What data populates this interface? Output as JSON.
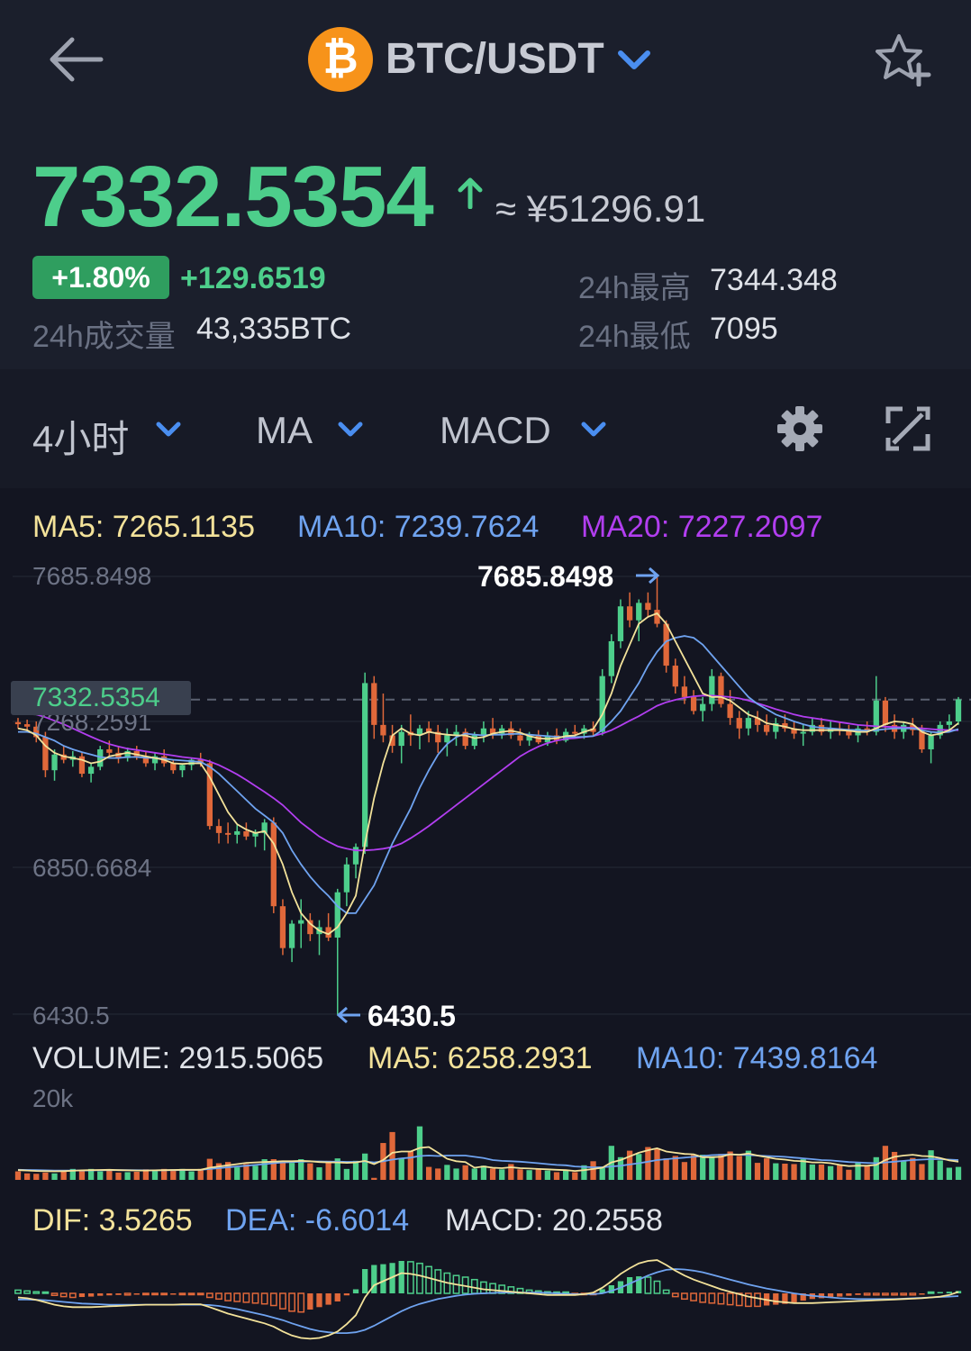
{
  "header": {
    "pair": "BTC/USDT",
    "coin_symbol": "₿",
    "back_icon": "arrow-left-icon",
    "star_icon": "star-plus-icon"
  },
  "ticker": {
    "price": "7332.5354",
    "approx": "≈ ¥51296.91",
    "change_pct": "+1.80%",
    "change_abs": "+129.6519",
    "high_label": "24h最高",
    "high_value": "7344.348",
    "low_label": "24h最低",
    "low_value": "7095",
    "volume_label": "24h成交量",
    "volume_value": "43,335BTC"
  },
  "toolbar": {
    "interval": "4小时",
    "main_indicator": "MA",
    "sub_indicator": "MACD"
  },
  "ma_legend": {
    "ma5": "MA5: 7265.1135",
    "ma10": "MA10: 7239.7624",
    "ma20": "MA20: 7227.2097"
  },
  "price_axis": {
    "top": "7685.8498",
    "mid": "7268.2591",
    "low": "6850.6684",
    "bottom": "6430.5",
    "current_tag": "7332.5354",
    "max_marker": "7685.8498",
    "min_marker": "6430.5"
  },
  "volume_legend": {
    "volume": "VOLUME: 2915.5065",
    "ma5": "MA5: 6258.2931",
    "ma10": "MA10: 7439.8164",
    "axis_top": "20k"
  },
  "macd_legend": {
    "dif": "DIF: 3.5265",
    "dea": "DEA: -6.6014",
    "macd": "MACD: 20.2558"
  },
  "colors": {
    "up": "#4dce8b",
    "down": "#e0683a",
    "ma5": "#f3e29a",
    "ma10": "#6fa3f0",
    "ma20": "#b23ef0",
    "background": "#131521"
  },
  "chart_data": {
    "type": "candlestick",
    "y_range": [
      6430.5,
      7685.8498
    ],
    "current_price": 7332.5354,
    "candles": [
      [
        7268,
        7280,
        7250,
        7262
      ],
      [
        7262,
        7275,
        7240,
        7255
      ],
      [
        7255,
        7270,
        7210,
        7225
      ],
      [
        7225,
        7240,
        7110,
        7130
      ],
      [
        7130,
        7190,
        7100,
        7175
      ],
      [
        7175,
        7200,
        7150,
        7160
      ],
      [
        7160,
        7185,
        7140,
        7170
      ],
      [
        7170,
        7180,
        7110,
        7120
      ],
      [
        7120,
        7150,
        7095,
        7140
      ],
      [
        7140,
        7200,
        7130,
        7190
      ],
      [
        7190,
        7215,
        7170,
        7180
      ],
      [
        7180,
        7200,
        7150,
        7165
      ],
      [
        7165,
        7195,
        7155,
        7185
      ],
      [
        7185,
        7200,
        7160,
        7170
      ],
      [
        7170,
        7185,
        7140,
        7150
      ],
      [
        7150,
        7180,
        7130,
        7170
      ],
      [
        7170,
        7190,
        7140,
        7150
      ],
      [
        7150,
        7160,
        7120,
        7130
      ],
      [
        7130,
        7150,
        7110,
        7145
      ],
      [
        7145,
        7165,
        7130,
        7160
      ],
      [
        7160,
        7180,
        7140,
        7150
      ],
      [
        7150,
        7160,
        6960,
        6970
      ],
      [
        6970,
        6990,
        6920,
        6950
      ],
      [
        6950,
        6980,
        6920,
        6945
      ],
      [
        6945,
        6975,
        6920,
        6955
      ],
      [
        6955,
        6980,
        6930,
        6940
      ],
      [
        6940,
        6960,
        6910,
        6950
      ],
      [
        6950,
        6990,
        6900,
        6980
      ],
      [
        6980,
        6995,
        6720,
        6740
      ],
      [
        6740,
        6760,
        6600,
        6620
      ],
      [
        6620,
        6700,
        6580,
        6690
      ],
      [
        6690,
        6760,
        6620,
        6700
      ],
      [
        6700,
        6720,
        6640,
        6660
      ],
      [
        6660,
        6700,
        6600,
        6680
      ],
      [
        6680,
        6720,
        6640,
        6650
      ],
      [
        6650,
        6790,
        6430,
        6780
      ],
      [
        6780,
        6880,
        6740,
        6860
      ],
      [
        6860,
        6920,
        6820,
        6910
      ],
      [
        6910,
        7410,
        6890,
        7380
      ],
      [
        7380,
        7400,
        7220,
        7260
      ],
      [
        7260,
        7350,
        7210,
        7230
      ],
      [
        7230,
        7260,
        7180,
        7200
      ],
      [
        7200,
        7260,
        7150,
        7240
      ],
      [
        7240,
        7290,
        7200,
        7230
      ],
      [
        7230,
        7260,
        7190,
        7250
      ],
      [
        7250,
        7270,
        7210,
        7240
      ],
      [
        7240,
        7260,
        7180,
        7210
      ],
      [
        7210,
        7250,
        7170,
        7230
      ],
      [
        7230,
        7260,
        7200,
        7240
      ],
      [
        7240,
        7250,
        7190,
        7200
      ],
      [
        7200,
        7240,
        7190,
        7230
      ],
      [
        7230,
        7270,
        7210,
        7250
      ],
      [
        7250,
        7280,
        7220,
        7235
      ],
      [
        7235,
        7260,
        7220,
        7250
      ],
      [
        7250,
        7270,
        7220,
        7230
      ],
      [
        7230,
        7250,
        7200,
        7215
      ],
      [
        7215,
        7240,
        7200,
        7230
      ],
      [
        7230,
        7245,
        7205,
        7210
      ],
      [
        7210,
        7240,
        7200,
        7230
      ],
      [
        7230,
        7250,
        7205,
        7215
      ],
      [
        7215,
        7250,
        7210,
        7240
      ],
      [
        7240,
        7260,
        7220,
        7235
      ],
      [
        7235,
        7260,
        7220,
        7250
      ],
      [
        7250,
        7270,
        7230,
        7240
      ],
      [
        7240,
        7420,
        7230,
        7400
      ],
      [
        7400,
        7520,
        7380,
        7500
      ],
      [
        7500,
        7620,
        7480,
        7600
      ],
      [
        7600,
        7640,
        7540,
        7560
      ],
      [
        7560,
        7620,
        7500,
        7610
      ],
      [
        7610,
        7640,
        7570,
        7590
      ],
      [
        7590,
        7686,
        7540,
        7550
      ],
      [
        7550,
        7560,
        7410,
        7430
      ],
      [
        7430,
        7450,
        7350,
        7370
      ],
      [
        7370,
        7400,
        7320,
        7340
      ],
      [
        7340,
        7360,
        7290,
        7300
      ],
      [
        7300,
        7340,
        7270,
        7320
      ],
      [
        7320,
        7420,
        7300,
        7400
      ],
      [
        7400,
        7410,
        7310,
        7320
      ],
      [
        7320,
        7360,
        7260,
        7280
      ],
      [
        7280,
        7300,
        7220,
        7250
      ],
      [
        7250,
        7300,
        7230,
        7280
      ],
      [
        7280,
        7300,
        7240,
        7260
      ],
      [
        7260,
        7290,
        7230,
        7240
      ],
      [
        7240,
        7280,
        7220,
        7265
      ],
      [
        7265,
        7290,
        7240,
        7250
      ],
      [
        7250,
        7270,
        7220,
        7235
      ],
      [
        7235,
        7260,
        7200,
        7240
      ],
      [
        7240,
        7280,
        7230,
        7260
      ],
      [
        7260,
        7280,
        7230,
        7240
      ],
      [
        7240,
        7270,
        7220,
        7250
      ],
      [
        7250,
        7270,
        7230,
        7245
      ],
      [
        7245,
        7260,
        7220,
        7230
      ],
      [
        7230,
        7260,
        7210,
        7250
      ],
      [
        7250,
        7270,
        7230,
        7240
      ],
      [
        7240,
        7400,
        7230,
        7330
      ],
      [
        7330,
        7340,
        7240,
        7260
      ],
      [
        7260,
        7290,
        7220,
        7240
      ],
      [
        7240,
        7270,
        7220,
        7260
      ],
      [
        7260,
        7280,
        7230,
        7245
      ],
      [
        7245,
        7260,
        7180,
        7190
      ],
      [
        7190,
        7240,
        7150,
        7230
      ],
      [
        7230,
        7270,
        7220,
        7260
      ],
      [
        7260,
        7290,
        7240,
        7270
      ],
      [
        7270,
        7340,
        7260,
        7333
      ]
    ],
    "ma5": [
      7250,
      7245,
      7230,
      7200,
      7180,
      7170,
      7165,
      7160,
      7150,
      7155,
      7170,
      7175,
      7180,
      7175,
      7170,
      7165,
      7160,
      7150,
      7148,
      7150,
      7150,
      7110,
      7060,
      7010,
      6975,
      6960,
      6950,
      6955,
      6920,
      6860,
      6780,
      6720,
      6690,
      6670,
      6660,
      6680,
      6720,
      6770,
      6920,
      7050,
      7150,
      7230,
      7250,
      7235,
      7230,
      7240,
      7235,
      7232,
      7230,
      7230,
      7222,
      7225,
      7235,
      7240,
      7243,
      7238,
      7228,
      7222,
      7220,
      7222,
      7228,
      7230,
      7240,
      7248,
      7290,
      7350,
      7430,
      7490,
      7550,
      7570,
      7580,
      7550,
      7500,
      7450,
      7400,
      7350,
      7340,
      7340,
      7330,
      7310,
      7290,
      7280,
      7265,
      7260,
      7255,
      7248,
      7245,
      7245,
      7245,
      7245,
      7245,
      7243,
      7240,
      7240,
      7250,
      7262,
      7270,
      7268,
      7262,
      7240,
      7230,
      7235,
      7245,
      7265
    ],
    "ma10": [
      7240,
      7240,
      7235,
      7225,
      7215,
      7200,
      7190,
      7182,
      7175,
      7168,
      7165,
      7165,
      7168,
      7168,
      7166,
      7165,
      7163,
      7160,
      7158,
      7156,
      7154,
      7140,
      7120,
      7095,
      7070,
      7045,
      7020,
      7000,
      6980,
      6950,
      6900,
      6860,
      6825,
      6795,
      6770,
      6740,
      6720,
      6720,
      6760,
      6800,
      6860,
      6920,
      6970,
      7020,
      7080,
      7130,
      7175,
      7205,
      7225,
      7235,
      7232,
      7230,
      7232,
      7232,
      7234,
      7234,
      7232,
      7230,
      7228,
      7226,
      7225,
      7225,
      7226,
      7228,
      7245,
      7270,
      7300,
      7340,
      7380,
      7430,
      7470,
      7500,
      7510,
      7515,
      7510,
      7490,
      7460,
      7430,
      7400,
      7370,
      7340,
      7320,
      7305,
      7290,
      7280,
      7270,
      7262,
      7255,
      7252,
      7250,
      7248,
      7246,
      7245,
      7244,
      7245,
      7248,
      7250,
      7250,
      7250,
      7245,
      7240,
      7238,
      7240,
      7248
    ],
    "ma20": [
      7300,
      7295,
      7290,
      7282,
      7272,
      7262,
      7250,
      7238,
      7226,
      7215,
      7205,
      7198,
      7192,
      7188,
      7184,
      7180,
      7176,
      7172,
      7168,
      7165,
      7162,
      7155,
      7145,
      7132,
      7118,
      7102,
      7085,
      7068,
      7050,
      7030,
      7005,
      6980,
      6960,
      6940,
      6925,
      6912,
      6905,
      6900,
      6900,
      6902,
      6905,
      6910,
      6920,
      6935,
      6952,
      6970,
      6990,
      7010,
      7030,
      7050,
      7070,
      7090,
      7110,
      7130,
      7150,
      7170,
      7185,
      7198,
      7208,
      7215,
      7220,
      7222,
      7225,
      7228,
      7235,
      7245,
      7258,
      7272,
      7285,
      7300,
      7315,
      7325,
      7332,
      7338,
      7342,
      7344,
      7344,
      7342,
      7340,
      7336,
      7330,
      7322,
      7314,
      7305,
      7298,
      7290,
      7284,
      7280,
      7276,
      7272,
      7268,
      7264,
      7260,
      7258,
      7256,
      7255,
      7254,
      7253,
      7252,
      7250,
      7248,
      7246,
      7245,
      7245
    ],
    "volume": [
      2100,
      1600,
      1500,
      1800,
      1600,
      2200,
      2700,
      2300,
      2700,
      2100,
      2500,
      1800,
      1900,
      2000,
      2600,
      2200,
      2700,
      2600,
      2700,
      2100,
      2700,
      5200,
      4100,
      4400,
      3100,
      3900,
      3500,
      5100,
      5100,
      4700,
      4200,
      5100,
      4100,
      3100,
      4700,
      5300,
      2700,
      4700,
      6500,
      500,
      9100,
      11800,
      5400,
      7100,
      13200,
      3200,
      2800,
      3700,
      2800,
      3600,
      2800,
      3500,
      2800,
      2600,
      3900,
      2600,
      2400,
      2600,
      2300,
      1900,
      2300,
      1900,
      3600,
      4600,
      3100,
      8400,
      5600,
      7200,
      6400,
      8100,
      7800,
      5300,
      5900,
      4400,
      6100,
      6200,
      5600,
      6400,
      7000,
      5900,
      7200,
      4200,
      5300,
      4100,
      4000,
      3900,
      5100,
      3800,
      3800,
      3400,
      3600,
      2500,
      4200,
      3600,
      5600,
      8400,
      6900,
      4700,
      5400,
      3900,
      7300,
      4800,
      3000,
      3200
    ],
    "vol_ma5": [
      2400,
      2300,
      2200,
      2150,
      2100,
      2150,
      2250,
      2350,
      2400,
      2450,
      2500,
      2400,
      2350,
      2300,
      2300,
      2350,
      2400,
      2450,
      2500,
      2500,
      2500,
      3000,
      3300,
      3600,
      3900,
      4200,
      4300,
      4400,
      4500,
      4600,
      4600,
      4700,
      4600,
      4400,
      4300,
      4300,
      4200,
      4300,
      4700,
      3900,
      4900,
      6700,
      7000,
      7000,
      7900,
      8100,
      6700,
      5200,
      4600,
      4400,
      3000,
      3300,
      3000,
      2900,
      3100,
      2900,
      2800,
      2700,
      2600,
      2500,
      2400,
      2200,
      2400,
      2700,
      3000,
      4300,
      4900,
      5800,
      6700,
      7300,
      7800,
      7000,
      6700,
      6400,
      6300,
      5600,
      5600,
      5700,
      6300,
      6200,
      6500,
      6000,
      5600,
      5200,
      5000,
      4700,
      4600,
      4300,
      4300,
      4100,
      3700,
      3400,
      3500,
      3500,
      3700,
      4900,
      5700,
      6000,
      6200,
      5900,
      5800,
      5400,
      4800,
      4500
    ],
    "vol_ma10": [
      2500,
      2450,
      2400,
      2350,
      2300,
      2300,
      2300,
      2320,
      2340,
      2380,
      2400,
      2400,
      2400,
      2380,
      2360,
      2360,
      2380,
      2400,
      2420,
      2440,
      2460,
      2700,
      2900,
      3100,
      3300,
      3500,
      3700,
      3900,
      4100,
      4300,
      4400,
      4500,
      4550,
      4550,
      4500,
      4500,
      4450,
      4450,
      4550,
      4300,
      4600,
      5000,
      5300,
      5500,
      5900,
      6000,
      5900,
      6000,
      6000,
      6000,
      5700,
      5400,
      4900,
      4700,
      4600,
      4500,
      4300,
      4100,
      3900,
      3700,
      3600,
      3300,
      3200,
      3100,
      3100,
      3300,
      3500,
      3800,
      4100,
      4500,
      4900,
      5100,
      5300,
      5500,
      5700,
      5900,
      6100,
      6200,
      6300,
      6200,
      6100,
      6000,
      5900,
      5800,
      5700,
      5500,
      5300,
      5100,
      4900,
      4800,
      4600,
      4400,
      4300,
      4200,
      4100,
      4300,
      4500,
      4700,
      4900,
      5000,
      5100,
      5100,
      5000,
      4900
    ],
    "macd_hist": [
      8,
      6,
      4,
      2,
      -5,
      -8,
      -10,
      -9,
      -8,
      -6,
      -5,
      -4,
      -4,
      -3,
      -3,
      -3,
      -3,
      -2,
      -2,
      -2,
      -2,
      -10,
      -14,
      -18,
      -20,
      -22,
      -24,
      -26,
      -30,
      -38,
      -44,
      -46,
      -40,
      -34,
      -28,
      -20,
      -5,
      10,
      60,
      70,
      72,
      75,
      80,
      78,
      74,
      66,
      58,
      50,
      44,
      40,
      34,
      28,
      24,
      20,
      16,
      12,
      8,
      6,
      4,
      2,
      0,
      -2,
      -2,
      -2,
      10,
      20,
      30,
      40,
      42,
      40,
      30,
      8,
      -8,
      -14,
      -18,
      -22,
      -24,
      -26,
      -28,
      -30,
      -32,
      -32,
      -30,
      -28,
      -26,
      -22,
      -18,
      -14,
      -12,
      -10,
      -8,
      -6,
      -4,
      -4,
      -4,
      -4,
      -4,
      -4,
      -4,
      -2,
      0,
      2,
      4,
      6
    ],
    "macd_dif": [
      -10,
      -12,
      -16,
      -22,
      -28,
      -32,
      -34,
      -34,
      -34,
      -33,
      -32,
      -31,
      -30,
      -29,
      -28,
      -28,
      -28,
      -28,
      -27,
      -27,
      -27,
      -34,
      -42,
      -50,
      -56,
      -62,
      -68,
      -74,
      -82,
      -94,
      -104,
      -110,
      -112,
      -110,
      -104,
      -94,
      -76,
      -54,
      -10,
      20,
      30,
      40,
      50,
      48,
      44,
      38,
      32,
      26,
      22,
      18,
      14,
      10,
      8,
      6,
      4,
      2,
      0,
      -2,
      -4,
      -4,
      -4,
      -4,
      -2,
      2,
      14,
      30,
      48,
      62,
      74,
      80,
      82,
      70,
      56,
      44,
      34,
      26,
      18,
      10,
      4,
      -2,
      -8,
      -12,
      -16,
      -20,
      -22,
      -24,
      -24,
      -24,
      -23,
      -22,
      -21,
      -20,
      -19,
      -18,
      -17,
      -16,
      -15,
      -14,
      -13,
      -12,
      -10,
      -8,
      -4,
      3.5
    ],
    "macd_dea": [
      -15,
      -15,
      -16,
      -17,
      -19,
      -21,
      -23,
      -25,
      -26,
      -27,
      -28,
      -28,
      -28,
      -28,
      -28,
      -28,
      -28,
      -28,
      -28,
      -28,
      -28,
      -29,
      -31,
      -35,
      -39,
      -44,
      -49,
      -54,
      -60,
      -66,
      -74,
      -81,
      -88,
      -93,
      -96,
      -98,
      -98,
      -96,
      -90,
      -80,
      -68,
      -56,
      -44,
      -34,
      -26,
      -20,
      -14,
      -10,
      -6,
      -3,
      -1,
      0,
      1,
      2,
      2,
      2,
      2,
      2,
      1,
      0,
      -1,
      -2,
      -2,
      -2,
      0,
      6,
      14,
      24,
      34,
      44,
      52,
      58,
      60,
      59,
      56,
      52,
      46,
      40,
      34,
      28,
      22,
      17,
      12,
      8,
      4,
      0,
      -3,
      -6,
      -8,
      -10,
      -12,
      -13,
      -14,
      -14,
      -14,
      -14,
      -14,
      -13,
      -12,
      -11,
      -10,
      -9,
      -8,
      -6.6
    ]
  }
}
